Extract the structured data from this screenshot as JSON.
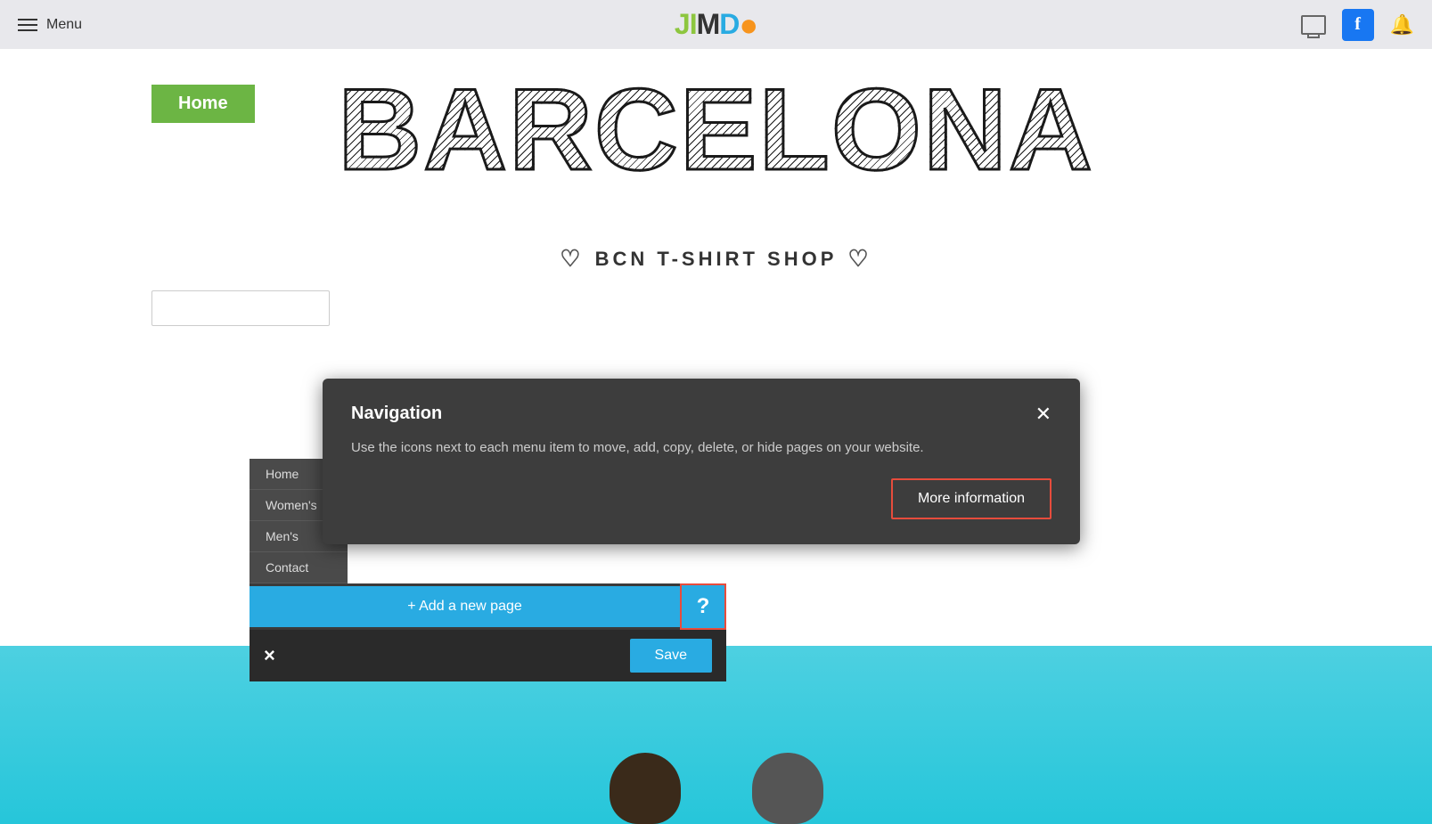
{
  "topbar": {
    "menu_label": "Menu",
    "logo": {
      "j": "JI",
      "m": "M",
      "d": "D",
      "o": "●"
    }
  },
  "page": {
    "barcelona_title": "BARCELONA",
    "bcn_subtitle": "BCN T-SHIRT SHOP"
  },
  "nav_menu": {
    "items": [
      "Home",
      "Women's",
      "Men's",
      "Contact"
    ]
  },
  "navigation_panel": {
    "title": "Navigation",
    "description": "Use the icons next to each menu item to move, add, copy, delete, or hide pages on your website.",
    "more_info_label": "More information",
    "add_page_label": "+ Add a new page",
    "help_label": "?",
    "cancel_label": "×",
    "save_label": "Save"
  },
  "home_bar": {
    "label": "Home"
  }
}
